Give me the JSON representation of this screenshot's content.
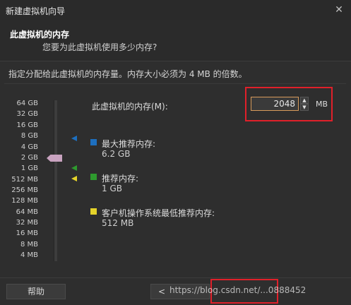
{
  "window": {
    "title": "新建虚拟机向导",
    "close_glyph": "✕"
  },
  "header": {
    "title": "此虚拟机的内存",
    "subtitle": "您要为此虚拟机使用多少内存?"
  },
  "instruction": "指定分配给此虚拟机的内存量。内存大小必须为 4 MB 的倍数。",
  "slider": {
    "ticks": [
      "64 GB",
      "32 GB",
      "16 GB",
      "8 GB",
      "4 GB",
      "2 GB",
      "1 GB",
      "512 MB",
      "256 MB",
      "128 MB",
      "64 MB",
      "32 MB",
      "16 MB",
      "8 MB",
      "4 MB"
    ],
    "current_value_mb": 2048
  },
  "memory": {
    "label": "此虚拟机的内存(M):",
    "value": "2048",
    "unit": "MB",
    "spin_up": "▲",
    "spin_down": "▼"
  },
  "legend": {
    "max": {
      "title": "最大推荐内存:",
      "value": "6.2 GB",
      "color": "#1d6fbf"
    },
    "recommended": {
      "title": "推荐内存:",
      "value": "1 GB",
      "color": "#2e9a2e"
    },
    "min": {
      "title": "客户机操作系统最低推荐内存:",
      "value": "512 MB",
      "color": "#e5d32a"
    }
  },
  "footer": {
    "help_label": "帮助",
    "back_label": "<",
    "watermark": "https://blog.csdn.net/...0888452"
  },
  "colors": {
    "highlight_red": "#e0202a",
    "thumb": "#c9a3c0"
  }
}
